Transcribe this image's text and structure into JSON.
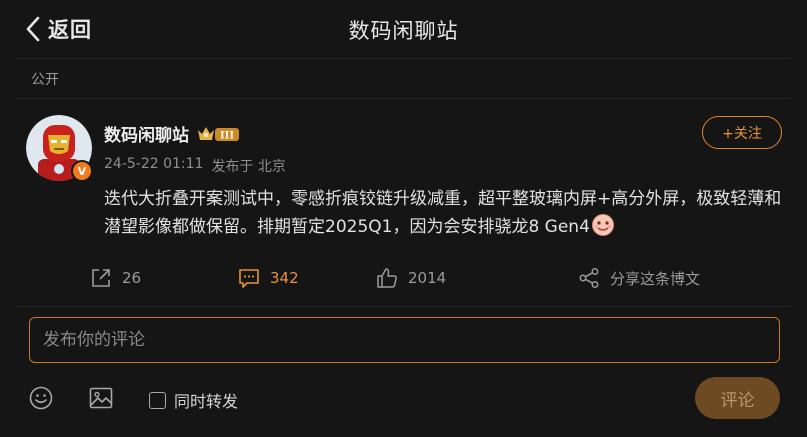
{
  "header": {
    "back_label": "返回",
    "title": "数码闲聊站"
  },
  "visibility_label": "公开",
  "post": {
    "author": "数码闲聊站",
    "level_badge": "III",
    "verified_badge": "V",
    "date": "24-5-22 01:11",
    "location": "发布于 北京",
    "follow_label": "+关注",
    "content": "迭代大折叠开案测试中，零感折痕铰链升级减重，超平整玻璃内屏+高分外屏，极致轻薄和潜望影像都做保留。排期暂定2025Q1，因为会安排骁龙8 Gen4",
    "emoji": "face-emoji"
  },
  "actions": {
    "repost_count": "26",
    "comment_count": "342",
    "like_count": "2014",
    "share_label": "分享这条博文"
  },
  "comment": {
    "placeholder": "发布你的评论",
    "repost_checkbox_label": "同时转发",
    "submit_label": "评论"
  },
  "colors": {
    "accent": "#e8923a",
    "background": "#151515",
    "submit_bg": "#6e4a22"
  },
  "icons": [
    "chevron-left-icon",
    "repost-icon",
    "comment-icon",
    "like-icon",
    "share-icon",
    "smiley-icon",
    "image-icon"
  ]
}
